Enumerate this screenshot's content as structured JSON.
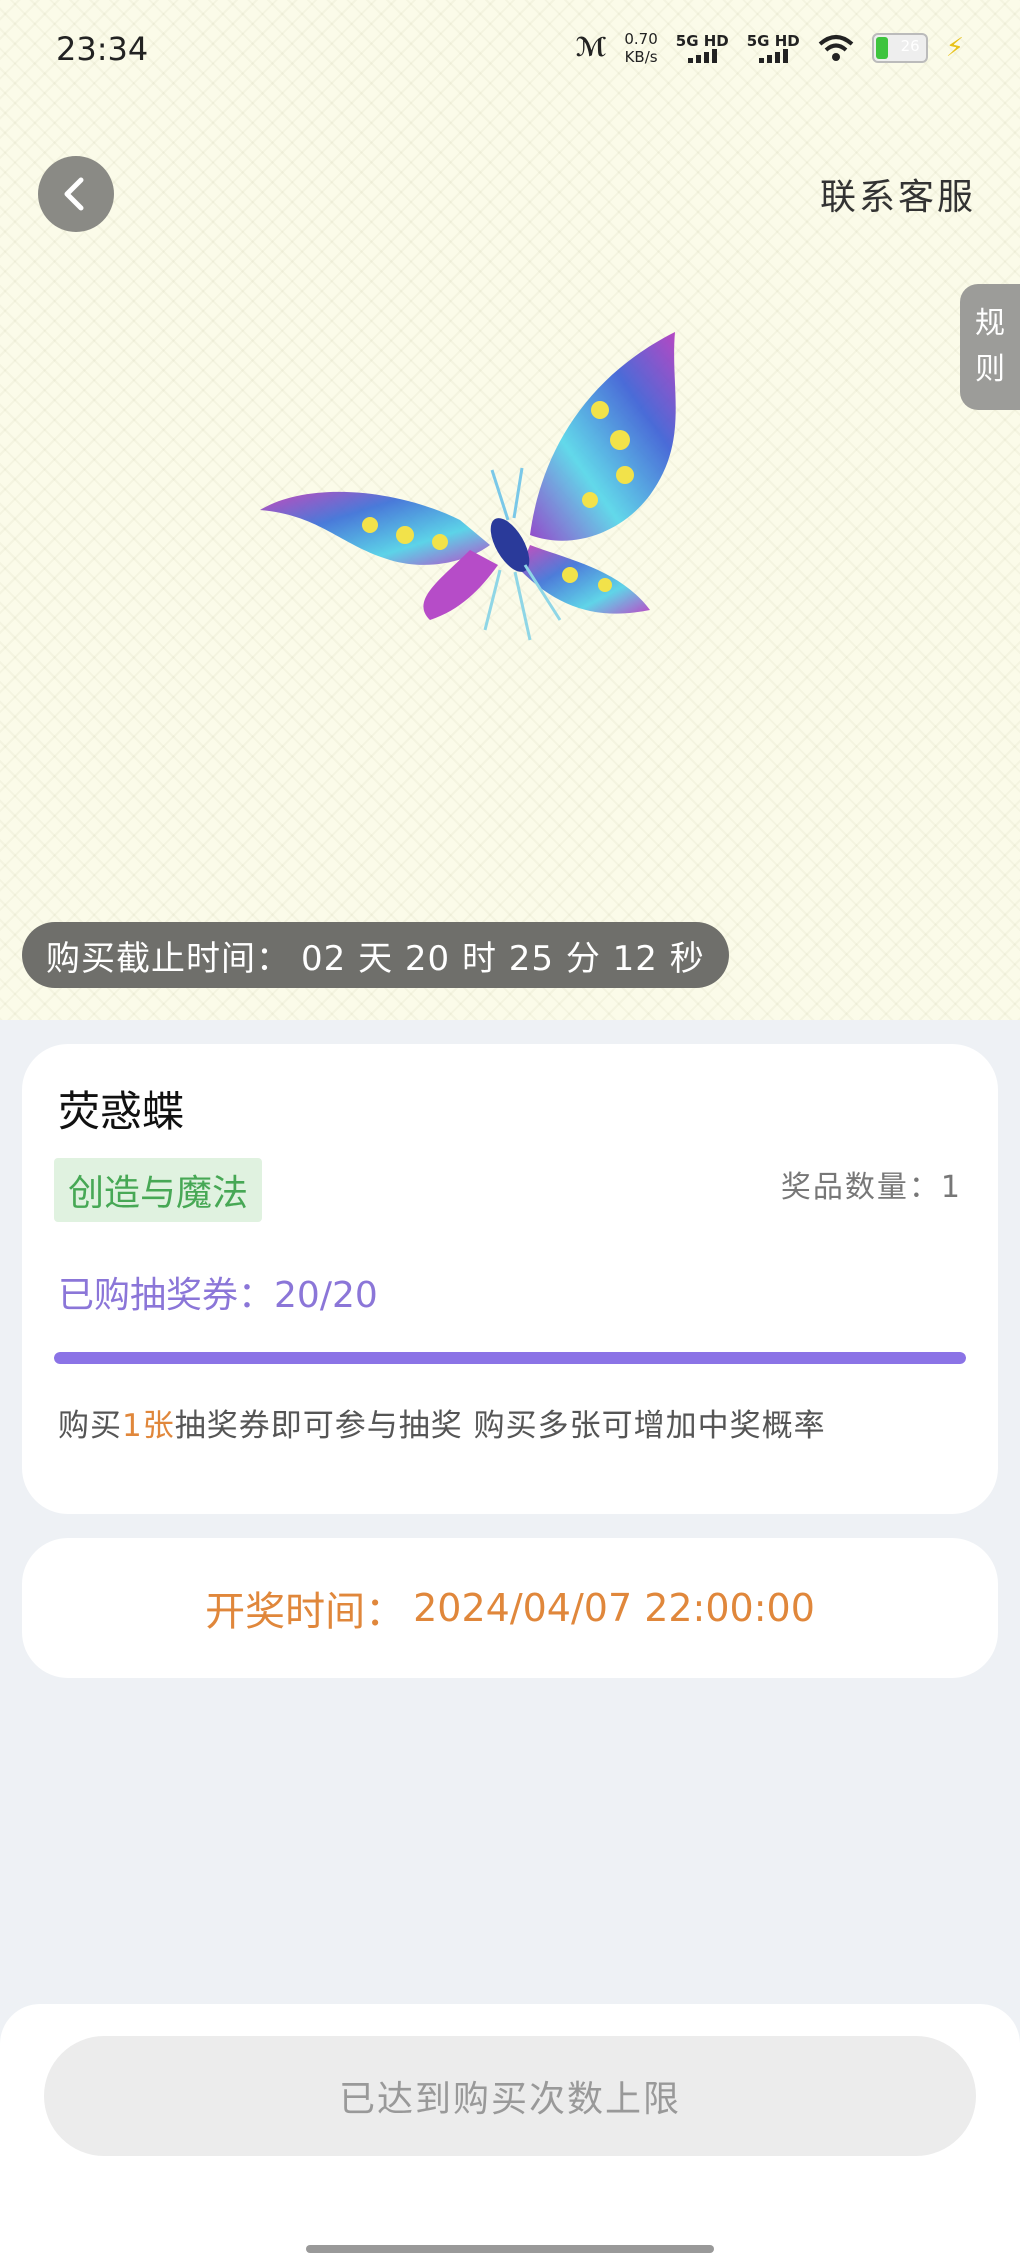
{
  "status_bar": {
    "time": "23:34",
    "net_speed_value": "0.70",
    "net_speed_unit": "KB/s",
    "sim1": "5G HD",
    "sim2": "5G HD",
    "battery_level": "26"
  },
  "header": {
    "contact_label": "联系客服",
    "rules_tab_chars": [
      "规",
      "则"
    ]
  },
  "hero": {
    "countdown_label": "购买截止时间：",
    "countdown_value": "02 天 20 时 25 分 12 秒"
  },
  "prize": {
    "name": "荧惑蝶",
    "category": "创造与魔法",
    "quantity_label": "奖品数量：",
    "quantity_value": "1",
    "tickets_label": "已购抽奖券：",
    "tickets_value": "20/20",
    "tickets_progress_fraction": 1.0,
    "hint_prefix": "购买",
    "hint_highlight": "1张",
    "hint_suffix": "抽奖券即可参与抽奖 购买多张可增加中奖概率"
  },
  "draw": {
    "label": "开奖时间：",
    "value": "2024/04/07 22:00:00"
  },
  "footer": {
    "button_label": "已达到购买次数上限"
  },
  "colors": {
    "accent_purple": "#8b73e6",
    "accent_orange": "#e0873b",
    "badge_green": "#47a855"
  }
}
